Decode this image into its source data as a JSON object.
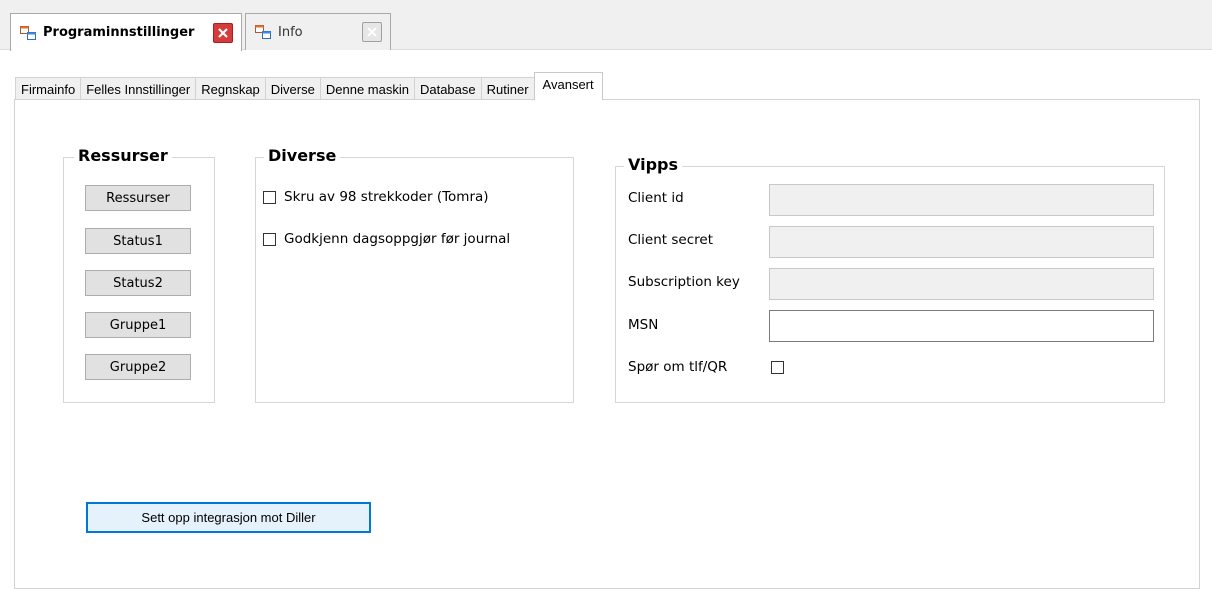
{
  "doc_tabs": [
    {
      "title": "Programinnstillinger",
      "icon": "window-app-icon",
      "close_icon": "close-icon"
    },
    {
      "title": "Info",
      "icon": "window-app-icon",
      "close_icon": "close-icon"
    }
  ],
  "settings_tabs": [
    "Firmainfo",
    "Felles Innstillinger",
    "Regnskap",
    "Diverse",
    "Denne maskin",
    "Database",
    "Rutiner",
    "Avansert"
  ],
  "active_settings_tab": "Avansert",
  "ressurser": {
    "title": "Ressurser",
    "buttons": [
      "Ressurser",
      "Status1",
      "Status2",
      "Gruppe1",
      "Gruppe2"
    ]
  },
  "diverse": {
    "title": "Diverse",
    "checkboxes": [
      {
        "label": "Skru av 98 strekkoder (Tomra)",
        "checked": false
      },
      {
        "label": "Godkjenn dagsoppgjør før journal",
        "checked": false
      }
    ]
  },
  "vipps": {
    "title": "Vipps",
    "fields": [
      {
        "label": "Client id",
        "value": "",
        "enabled": false
      },
      {
        "label": "Client secret",
        "value": "",
        "enabled": false
      },
      {
        "label": "Subscription key",
        "value": "",
        "enabled": false
      },
      {
        "label": "MSN",
        "value": "",
        "enabled": true
      }
    ],
    "ask_phone_label": "Spør om tlf/QR",
    "ask_phone_checked": false
  },
  "diller_button": "Sett opp integrasjon mot Diller",
  "colors": {
    "close_active": "#d73a3a",
    "focus_border": "#0078d7",
    "disabled_input": "#f0f0f0"
  }
}
